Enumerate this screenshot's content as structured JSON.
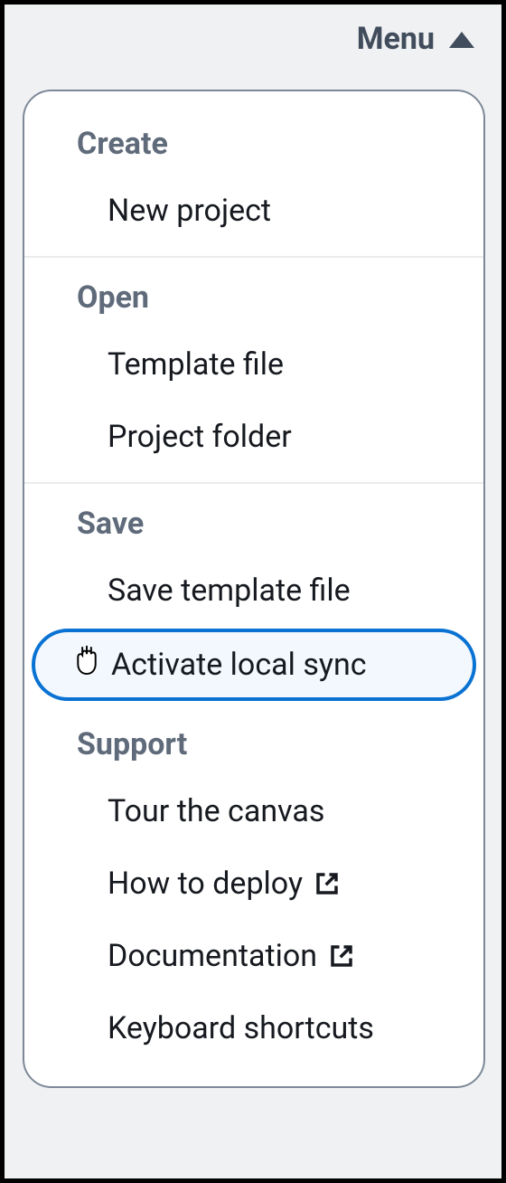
{
  "menu": {
    "trigger_label": "Menu",
    "sections": [
      {
        "header": "Create",
        "items": [
          {
            "label": "New project",
            "external": false,
            "highlighted": false
          }
        ]
      },
      {
        "header": "Open",
        "items": [
          {
            "label": "Template file",
            "external": false,
            "highlighted": false
          },
          {
            "label": "Project folder",
            "external": false,
            "highlighted": false
          }
        ]
      },
      {
        "header": "Save",
        "items": [
          {
            "label": "Save template file",
            "external": false,
            "highlighted": false
          },
          {
            "label": "Activate local sync",
            "external": false,
            "highlighted": true
          }
        ]
      },
      {
        "header": "Support",
        "items": [
          {
            "label": "Tour the canvas",
            "external": false,
            "highlighted": false
          },
          {
            "label": "How to deploy",
            "external": true,
            "highlighted": false
          },
          {
            "label": "Documentation",
            "external": true,
            "highlighted": false
          },
          {
            "label": "Keyboard shortcuts",
            "external": false,
            "highlighted": false
          }
        ]
      }
    ]
  }
}
